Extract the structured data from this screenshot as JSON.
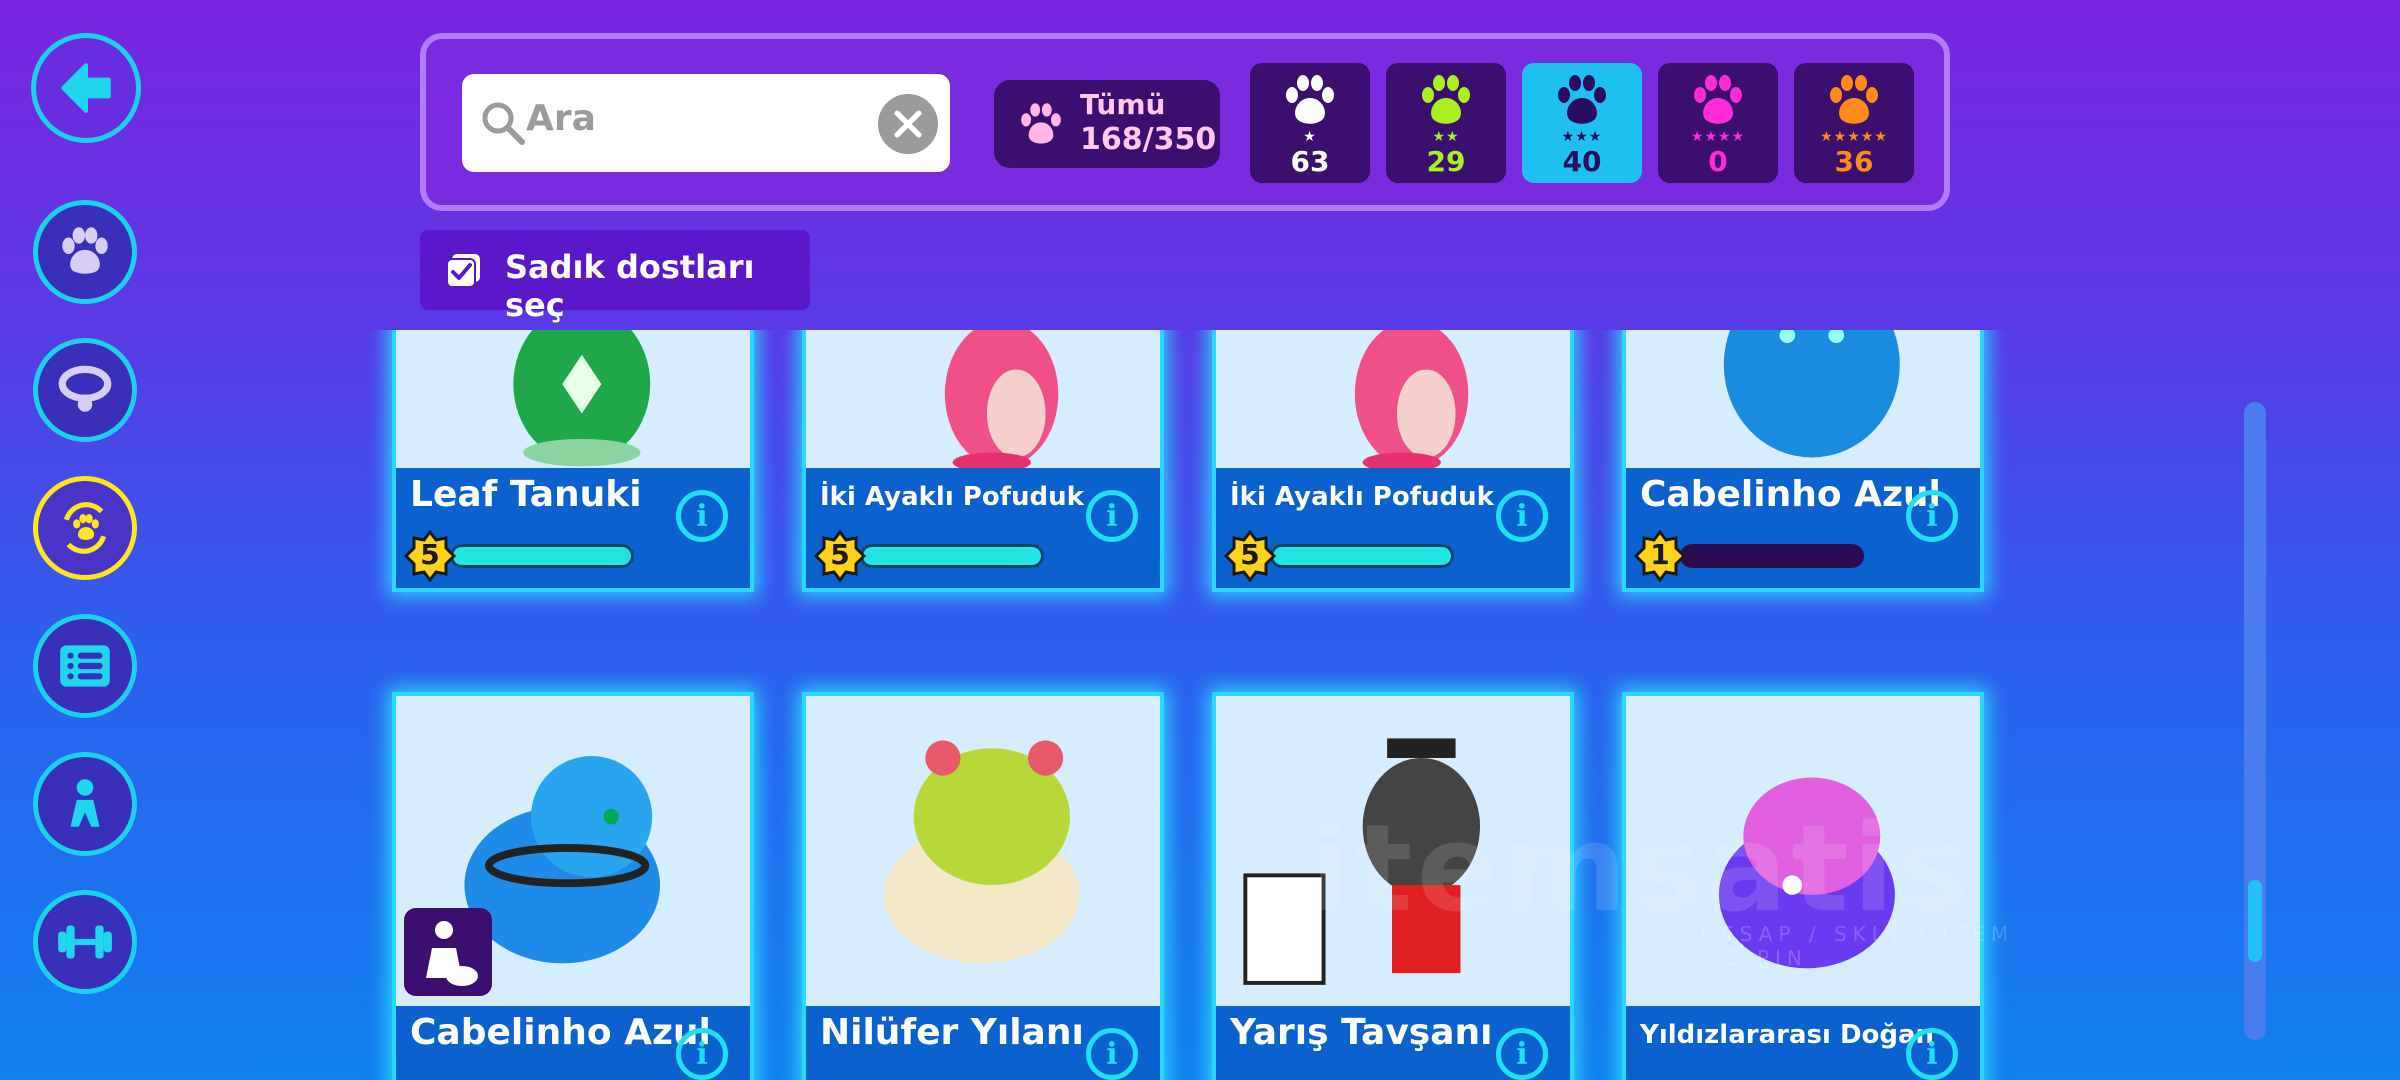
{
  "search": {
    "placeholder": "Ara"
  },
  "filters": {
    "all_label": "Tümü",
    "all_count": "168/350",
    "star_filters": [
      {
        "stars": "★",
        "count": "63",
        "color": "#ffffff",
        "selected": false
      },
      {
        "stars": "★★",
        "count": "29",
        "color": "#a8f020",
        "selected": false
      },
      {
        "stars": "★★★",
        "count": "40",
        "color": "#2a0c60",
        "selected": true
      },
      {
        "stars": "★★★★",
        "count": "0",
        "color": "#ff2ad8",
        "selected": false
      },
      {
        "stars": "★★★★★",
        "count": "36",
        "color": "#ff8a1a",
        "selected": false
      }
    ]
  },
  "loyal_button": {
    "label": "Sadık dostları seç"
  },
  "nav": {
    "icons": [
      "back-arrow-icon",
      "paw-icon",
      "collar-icon",
      "swap-paw-icon",
      "list-icon",
      "trainer-icon",
      "dumbbell-icon"
    ]
  },
  "pets_row1": [
    {
      "name": "Leaf Tanuki",
      "level": "5",
      "progress": 1.0,
      "small": false
    },
    {
      "name": "İki Ayaklı Pofuduk",
      "level": "5",
      "progress": 1.0,
      "small": true
    },
    {
      "name": "İki Ayaklı Pofuduk",
      "level": "5",
      "progress": 1.0,
      "small": true
    },
    {
      "name": "Cabelinho Azul",
      "level": "1",
      "progress": 0.0,
      "small": false
    }
  ],
  "pets_row2": [
    {
      "name": "Cabelinho Azul",
      "small": false
    },
    {
      "name": "Nilüfer Yılanı",
      "small": false
    },
    {
      "name": "Yarış Tavşanı",
      "small": false
    },
    {
      "name": "Yıldızlararası Doğan",
      "small": true
    }
  ],
  "colors": {
    "accent": "#19d2ea",
    "panel": "#3a0f6e",
    "card_footer": "#0b62cf"
  }
}
